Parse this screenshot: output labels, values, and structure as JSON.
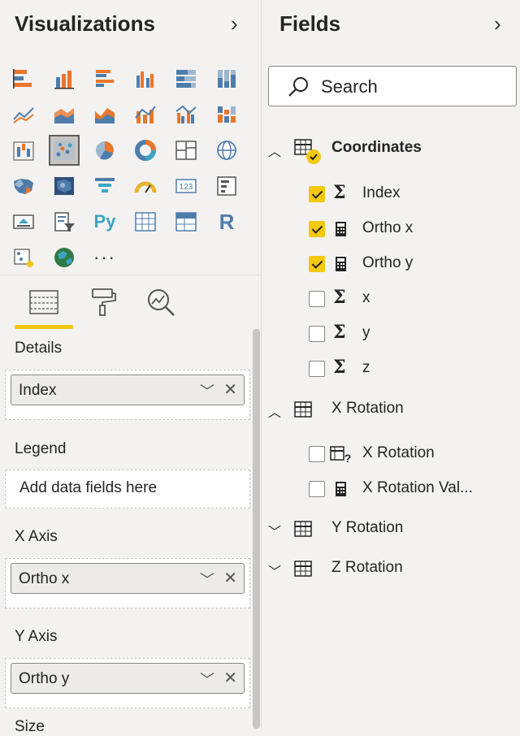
{
  "visualizations": {
    "title": "Visualizations",
    "expand_icon": "chevron-right-icon",
    "icons": [
      {
        "name": "stacked-bar-chart-icon"
      },
      {
        "name": "stacked-column-chart-icon"
      },
      {
        "name": "clustered-bar-chart-icon"
      },
      {
        "name": "clustered-column-chart-icon"
      },
      {
        "name": "100-stacked-bar-chart-icon"
      },
      {
        "name": "100-stacked-column-chart-icon"
      },
      {
        "name": "line-chart-icon"
      },
      {
        "name": "area-chart-icon"
      },
      {
        "name": "stacked-area-chart-icon"
      },
      {
        "name": "line-and-stacked-column-chart-icon"
      },
      {
        "name": "line-and-clustered-column-chart-icon"
      },
      {
        "name": "ribbon-chart-icon"
      },
      {
        "name": "waterfall-chart-icon"
      },
      {
        "name": "scatter-chart-icon",
        "selected": true
      },
      {
        "name": "pie-chart-icon"
      },
      {
        "name": "donut-chart-icon"
      },
      {
        "name": "treemap-icon"
      },
      {
        "name": "map-icon"
      },
      {
        "name": "filled-map-icon"
      },
      {
        "name": "shape-map-icon"
      },
      {
        "name": "funnel-icon"
      },
      {
        "name": "gauge-icon"
      },
      {
        "name": "card-icon",
        "text": "123"
      },
      {
        "name": "multi-row-card-icon"
      },
      {
        "name": "kpi-icon"
      },
      {
        "name": "slicer-icon"
      },
      {
        "name": "python-visual-icon",
        "text": "Py"
      },
      {
        "name": "table-icon"
      },
      {
        "name": "matrix-icon"
      },
      {
        "name": "r-visual-icon",
        "text": "R"
      },
      {
        "name": "key-influencers-icon"
      },
      {
        "name": "arcgis-map-icon"
      },
      {
        "name": "more-visuals-icon",
        "text": "···"
      }
    ],
    "tabs": [
      {
        "name": "tab-fields",
        "icon": "fields-well-icon",
        "active": true
      },
      {
        "name": "tab-format",
        "icon": "paint-roller-icon",
        "active": false
      },
      {
        "name": "tab-analytics",
        "icon": "analytics-magnifier-icon",
        "active": false
      }
    ],
    "wells": {
      "details": {
        "label": "Details",
        "value": "Index"
      },
      "legend": {
        "label": "Legend",
        "placeholder": "Add data fields here"
      },
      "x_axis": {
        "label": "X Axis",
        "value": "Ortho x"
      },
      "y_axis": {
        "label": "Y Axis",
        "value": "Ortho y"
      },
      "size": {
        "label": "Size"
      }
    },
    "pill_dropdown": "﹀",
    "pill_remove": "✕"
  },
  "fields": {
    "title": "Fields",
    "search_placeholder": "Search",
    "tables": [
      {
        "name": "Coordinates",
        "expanded": true,
        "bold": true,
        "checked": true,
        "items": [
          {
            "label": "Index",
            "type": "sigma",
            "checked": true
          },
          {
            "label": "Ortho x",
            "type": "calc",
            "checked": true
          },
          {
            "label": "Ortho y",
            "type": "calc",
            "checked": true
          },
          {
            "label": "x",
            "type": "sigma",
            "checked": false
          },
          {
            "label": "y",
            "type": "sigma",
            "checked": false
          },
          {
            "label": "z",
            "type": "sigma",
            "checked": false
          }
        ]
      },
      {
        "name": "X Rotation",
        "expanded": true,
        "bold": false,
        "items": [
          {
            "label": "X Rotation",
            "type": "param",
            "checked": false
          },
          {
            "label": "X Rotation Val...",
            "type": "calc",
            "checked": false
          }
        ]
      },
      {
        "name": "Y Rotation",
        "expanded": false,
        "bold": false,
        "items": []
      },
      {
        "name": "Z Rotation",
        "expanded": false,
        "bold": false,
        "items": []
      }
    ]
  },
  "colors": {
    "accent": "#f2c811",
    "bg": "#f3f2f1",
    "chart_blue": "#4f7dab",
    "chart_orange": "#e8762c",
    "chart_teal": "#3fa4c1"
  }
}
